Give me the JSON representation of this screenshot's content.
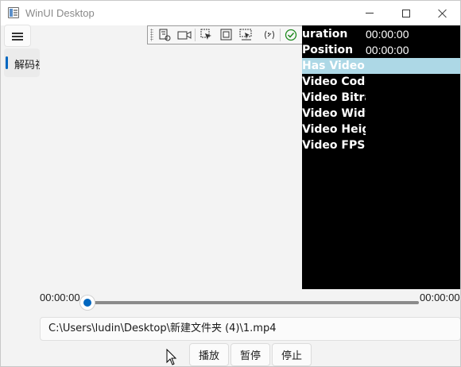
{
  "window": {
    "title": "WinUI Desktop"
  },
  "caption": {
    "minimize": "minimize",
    "maximize": "maximize",
    "close": "close"
  },
  "nav": {
    "menu_icon": "hamburger-icon",
    "items": [
      {
        "label": "解码视频",
        "selected": true
      }
    ]
  },
  "debug_toolbar": {
    "icons": [
      "live-visual-tree-icon",
      "video-camera-icon",
      "select-element-icon",
      "display-layout-adorners-icon",
      "track-focus-icon",
      "binding-failures-icon",
      "hot-reload-ok-icon",
      "collapse-chevron-icon"
    ]
  },
  "video_info": {
    "rows": [
      {
        "name": "Duration",
        "visible_name": "uration",
        "value": "00:00:00"
      },
      {
        "name": "Position",
        "value": "00:00:00"
      },
      {
        "name": "Has Video",
        "value": "",
        "selected": true
      },
      {
        "name": "Video Codec",
        "value": ""
      },
      {
        "name": "Video Bitrate",
        "value": ""
      },
      {
        "name": "Video Width",
        "value": ""
      },
      {
        "name": "Video Height",
        "value": ""
      },
      {
        "name": "Video FPS",
        "value": ""
      }
    ]
  },
  "timeline": {
    "current": "00:00:00",
    "total": "00:00:00",
    "progress": 0
  },
  "file": {
    "path": "C:\\Users\\ludin\\Desktop\\新建文件夹 (4)\\1.mp4"
  },
  "controls": {
    "play": "播放",
    "pause": "暂停",
    "stop": "停止"
  },
  "colors": {
    "accent": "#0067c0",
    "selected_row": "#add8e6",
    "video_bg": "#000000"
  }
}
